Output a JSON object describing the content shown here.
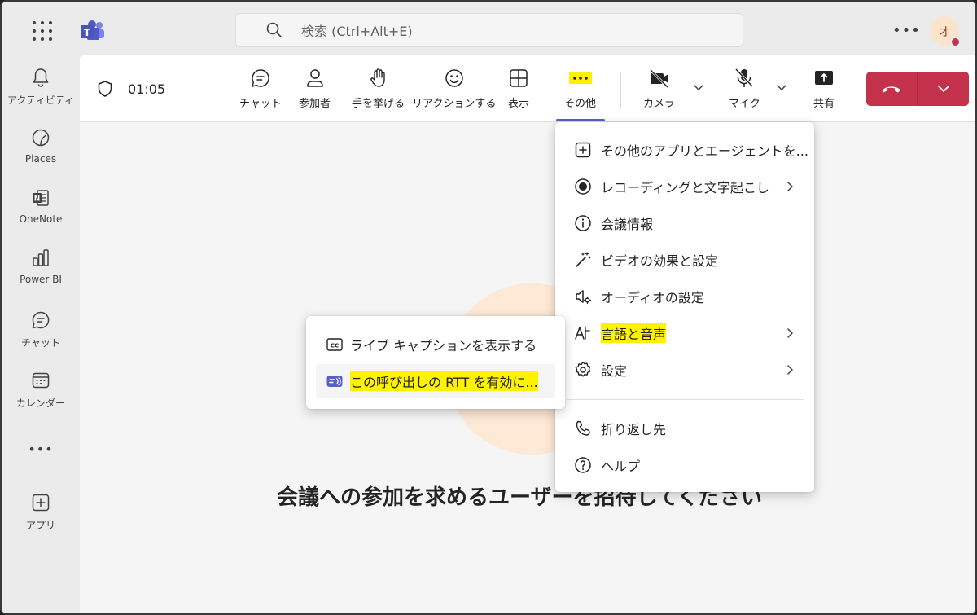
{
  "topbar": {
    "search_placeholder": "検索 (Ctrl+Alt+E)",
    "more_label": "•••",
    "avatar_initial": "オ"
  },
  "rail": {
    "items": [
      {
        "label": "アクティビティ",
        "icon": "bell-icon"
      },
      {
        "label": "Places",
        "icon": "places-icon"
      },
      {
        "label": "OneNote",
        "icon": "onenote-icon"
      },
      {
        "label": "Power BI",
        "icon": "powerbi-icon"
      },
      {
        "label": "チャット",
        "icon": "chat-icon"
      },
      {
        "label": "カレンダー",
        "icon": "calendar-icon"
      },
      {
        "label": "•••",
        "icon": "more-icon"
      },
      {
        "label": "アプリ",
        "icon": "add-apps-icon"
      }
    ]
  },
  "toolbar": {
    "timer": "01:05",
    "chat": "チャット",
    "people": "参加者",
    "raise": "手を挙げる",
    "react": "リアクションする",
    "view": "表示",
    "more": "その他",
    "camera": "カメラ",
    "mic": "マイク",
    "share": "共有"
  },
  "main": {
    "invite_text": "会議への参加を求めるユーザーを招待してください"
  },
  "menu": {
    "items": [
      {
        "label": "その他のアプリとエージェントを...",
        "icon": "add-square-icon"
      },
      {
        "label": "レコーディングと文字起こし",
        "icon": "record-icon"
      },
      {
        "label": "会議情報",
        "icon": "info-icon"
      },
      {
        "label": "ビデオの効果と設定",
        "icon": "magic-wand-icon"
      },
      {
        "label": "オーディオの設定",
        "icon": "speaker-settings-icon"
      },
      {
        "label": "言語と音声",
        "icon": "language-icon"
      },
      {
        "label": "設定",
        "icon": "gear-icon"
      },
      {
        "label": "折り返し先",
        "icon": "phone-icon"
      },
      {
        "label": "ヘルプ",
        "icon": "help-icon"
      }
    ]
  },
  "submenu": {
    "items": [
      {
        "label": "ライブ キャプションを表示する",
        "icon": "cc-icon"
      },
      {
        "label": "この呼び出しの RTT を有効に...",
        "icon": "rtt-icon"
      }
    ]
  },
  "colors": {
    "accent": "#5b5fc7",
    "hangup": "#c4314b",
    "highlight": "#fff200"
  }
}
